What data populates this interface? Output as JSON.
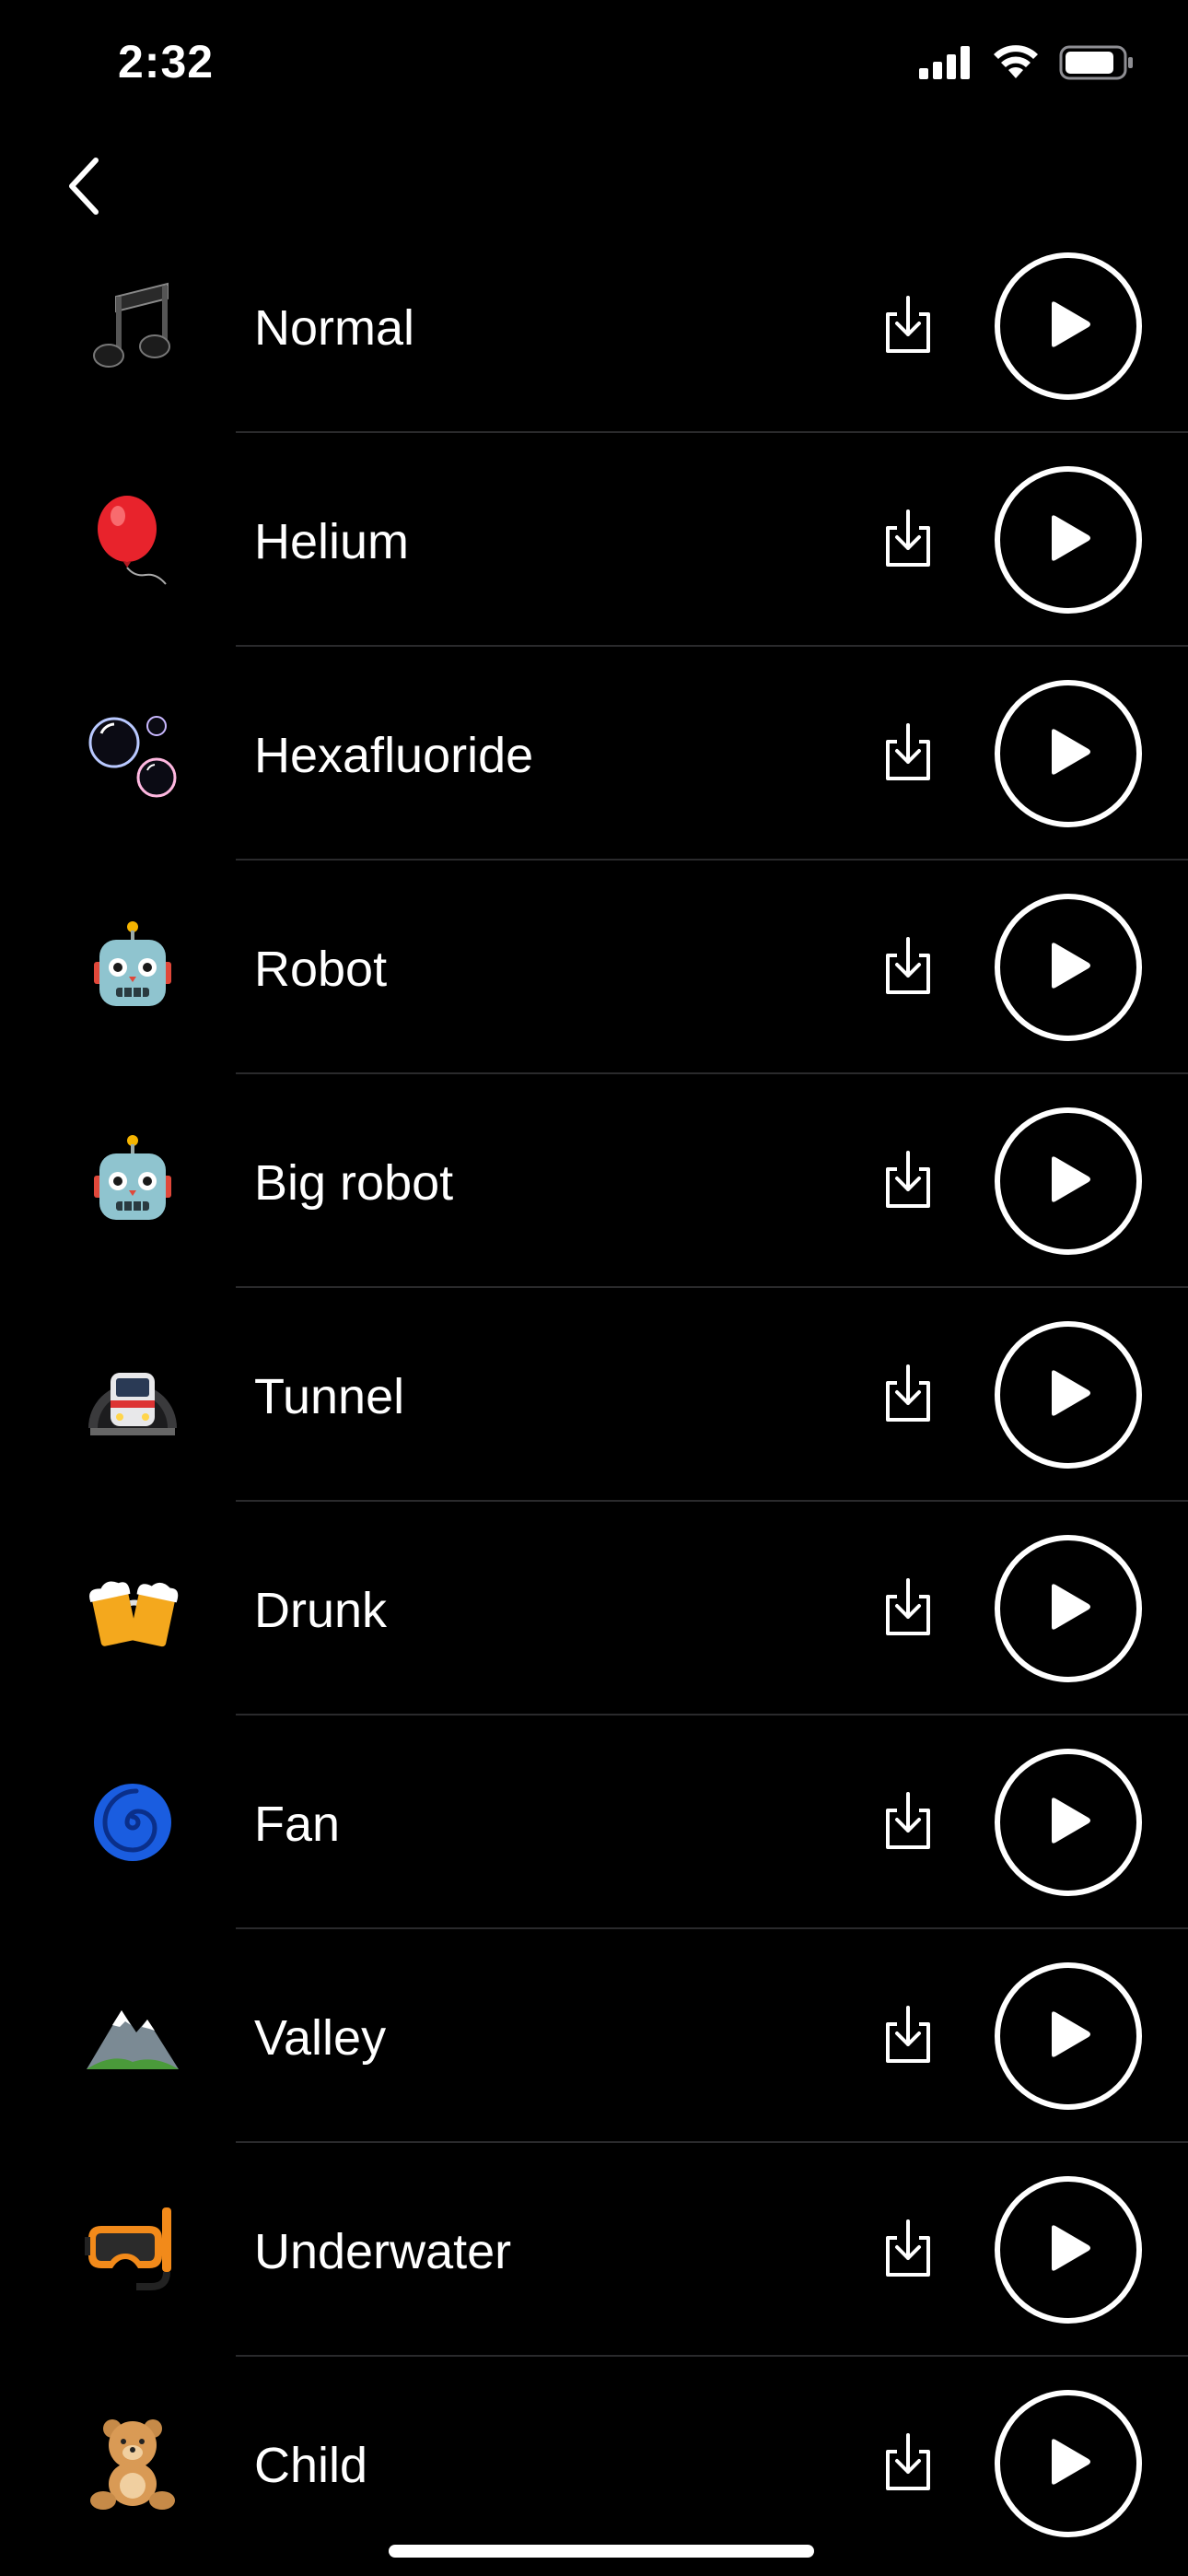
{
  "status_bar": {
    "time": "2:32",
    "signal_icon": "cellular-signal-icon",
    "wifi_icon": "wifi-icon",
    "battery_icon": "battery-icon"
  },
  "nav": {
    "back_icon": "chevron-left-icon"
  },
  "effects": [
    {
      "id": "normal",
      "name": "Normal",
      "emoji": "musical-notes-icon"
    },
    {
      "id": "helium",
      "name": "Helium",
      "emoji": "balloon-icon"
    },
    {
      "id": "hexafluoride",
      "name": "Hexafluoride",
      "emoji": "bubbles-icon"
    },
    {
      "id": "robot",
      "name": "Robot",
      "emoji": "robot-icon"
    },
    {
      "id": "big-robot",
      "name": "Big robot",
      "emoji": "robot-icon"
    },
    {
      "id": "tunnel",
      "name": "Tunnel",
      "emoji": "metro-train-icon"
    },
    {
      "id": "drunk",
      "name": "Drunk",
      "emoji": "beer-mugs-icon"
    },
    {
      "id": "fan",
      "name": "Fan",
      "emoji": "cyclone-icon"
    },
    {
      "id": "valley",
      "name": "Valley",
      "emoji": "snow-mountain-icon"
    },
    {
      "id": "underwater",
      "name": "Underwater",
      "emoji": "diving-mask-icon"
    },
    {
      "id": "child",
      "name": "Child",
      "emoji": "teddy-bear-icon"
    }
  ],
  "row_actions": {
    "download_icon": "download-icon",
    "play_icon": "play-icon"
  },
  "colors": {
    "background": "#000000",
    "text": "#ffffff",
    "divider": "#2a2a2c"
  }
}
